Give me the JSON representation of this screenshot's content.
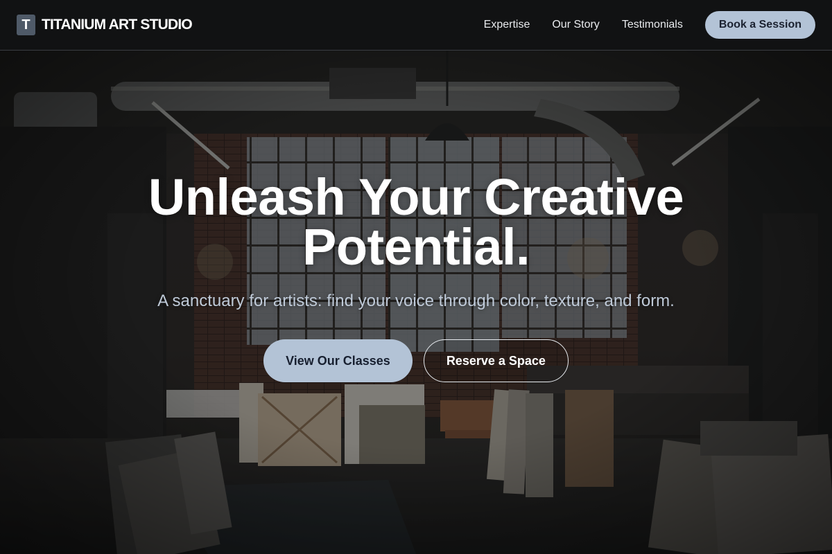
{
  "brand": {
    "mark": "T",
    "name": "TITANIUM ART STUDIO"
  },
  "nav": {
    "links": [
      "Expertise",
      "Our Story",
      "Testimonials"
    ],
    "cta": "Book a Session"
  },
  "hero": {
    "title": "Unleash Your Creative Potential.",
    "subtitle": "A sanctuary for artists: find your voice through color, texture, and form.",
    "primary_button": "View Our Classes",
    "secondary_button": "Reserve a Space"
  },
  "colors": {
    "nav_bg": "#111213",
    "accent": "#b3c3d6",
    "accent_text": "#182030",
    "subtitle": "#bfcad8"
  }
}
